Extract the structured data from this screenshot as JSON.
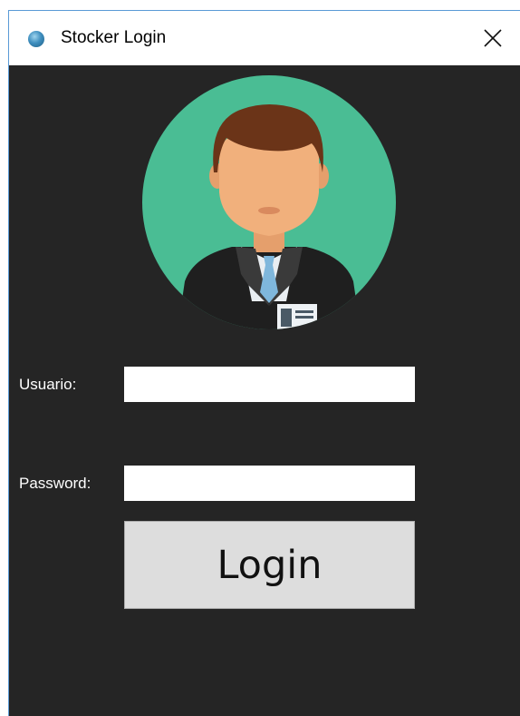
{
  "window": {
    "title": "Stocker Login",
    "app_icon": "globe-icon",
    "close_icon": "close-icon"
  },
  "avatar": {
    "icon": "businessman-avatar-icon",
    "colors": {
      "circle": "#4abd94",
      "suit": "#1f1f1f",
      "hair": "#6b3418",
      "skin": "#f1b07c",
      "tie": "#7fb7dc"
    }
  },
  "form": {
    "usuario_label": "Usuario:",
    "usuario_value": "",
    "password_label": "Password:",
    "password_value": "",
    "login_label": "Login"
  },
  "colors": {
    "background": "#252525",
    "button": "#dddddd",
    "titlebar": "#ffffff"
  }
}
